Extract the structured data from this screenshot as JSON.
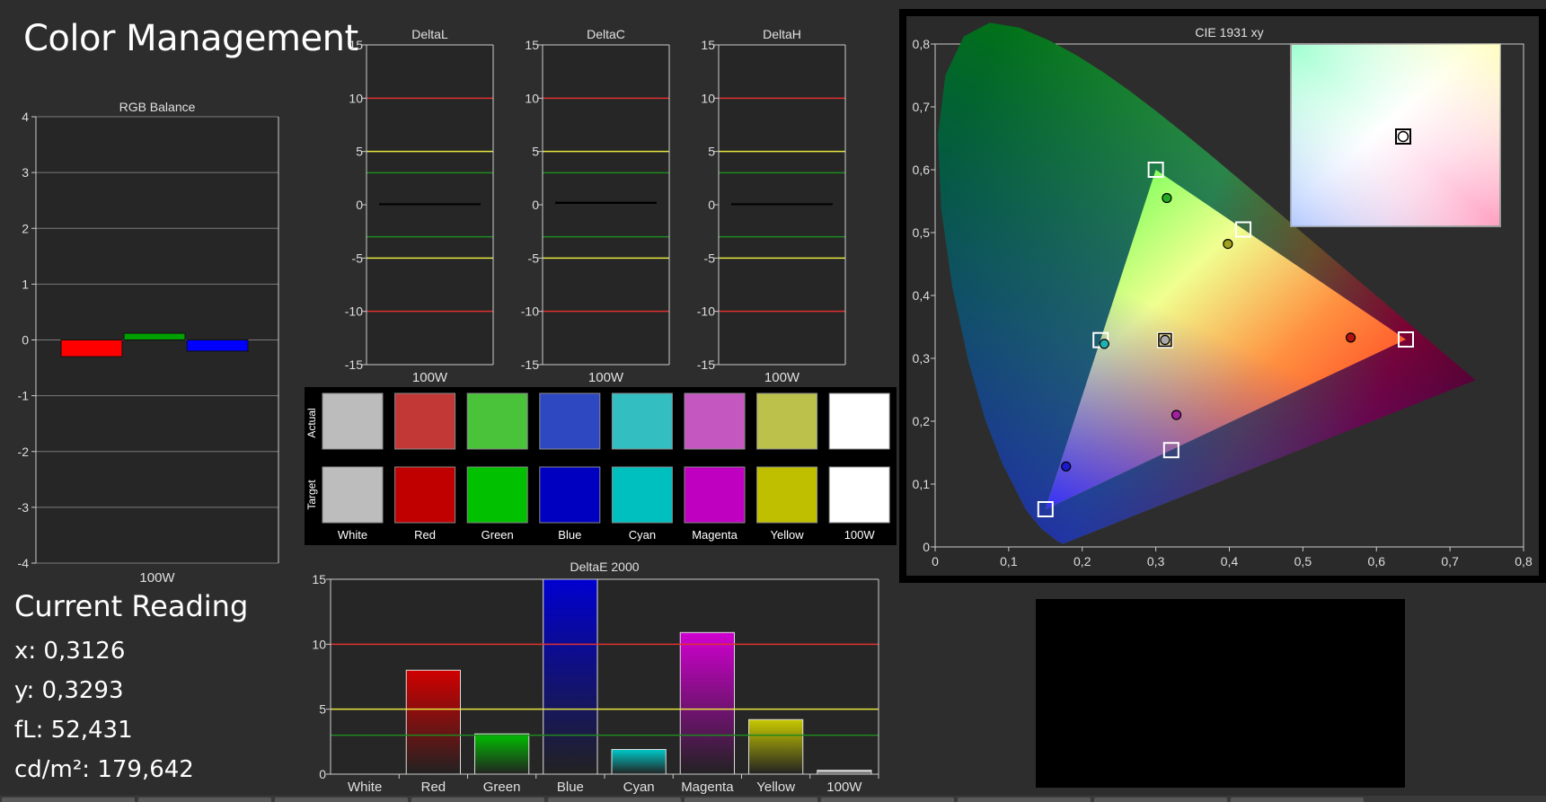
{
  "page": {
    "title": "Color Management",
    "colors": {
      "background": "#2d2d2d",
      "panel": "#262626",
      "grid": "#7a7a7a"
    }
  },
  "current_reading": {
    "heading": "Current Reading",
    "x_line": "x: 0,3126",
    "y_line": "y: 0,3293",
    "fl_line": "fL: 52,431",
    "cdm2_line": "cd/m²: 179,642"
  },
  "swatches": {
    "row_labels": [
      "Actual",
      "Target"
    ],
    "names": [
      "White",
      "Red",
      "Green",
      "Blue",
      "Cyan",
      "Magenta",
      "Yellow",
      "100W"
    ],
    "actual_colors": [
      "#bcbcbc",
      "#c23837",
      "#4ac33b",
      "#2e48c2",
      "#33bfc1",
      "#c458c0",
      "#bcc14b",
      "#ffffff"
    ],
    "target_colors": [
      "#bdbdbd",
      "#c00000",
      "#00c000",
      "#0000c0",
      "#00bfbf",
      "#c000c0",
      "#bfbf00",
      "#ffffff"
    ]
  },
  "chart_data": [
    {
      "type": "bar",
      "title": "RGB Balance",
      "categories": [
        "100W"
      ],
      "series": [
        {
          "color": "#ff0000",
          "values": [
            -0.3
          ]
        },
        {
          "color": "#00a000",
          "values": [
            0.12
          ]
        },
        {
          "color": "#0000ff",
          "values": [
            -0.2
          ]
        }
      ],
      "ylim": [
        -4,
        4
      ],
      "yticks": [
        "-4",
        "-3",
        "-2",
        "-1",
        "0",
        "1",
        "2",
        "3",
        "4"
      ],
      "grid": true
    },
    {
      "type": "bar",
      "title": "DeltaL",
      "categories": [
        "100W"
      ],
      "values": [
        0.05
      ],
      "ylim": [
        -15,
        15
      ],
      "yticks": [
        "-15",
        "-10",
        "-5",
        "0",
        "5",
        "10",
        "15"
      ],
      "reference_lines": [
        {
          "value": 10,
          "color": "#e03030"
        },
        {
          "value": 5,
          "color": "#e8e840"
        },
        {
          "value": 3,
          "color": "#1f8a1f"
        },
        {
          "value": -3,
          "color": "#1f8a1f"
        },
        {
          "value": -5,
          "color": "#e8e840"
        },
        {
          "value": -10,
          "color": "#e03030"
        }
      ]
    },
    {
      "type": "bar",
      "title": "DeltaC",
      "categories": [
        "100W"
      ],
      "values": [
        0.2
      ],
      "ylim": [
        -15,
        15
      ],
      "yticks": [
        "-15",
        "-10",
        "-5",
        "0",
        "5",
        "10",
        "15"
      ],
      "reference_lines": [
        {
          "value": 10,
          "color": "#e03030"
        },
        {
          "value": 5,
          "color": "#e8e840"
        },
        {
          "value": 3,
          "color": "#1f8a1f"
        },
        {
          "value": -3,
          "color": "#1f8a1f"
        },
        {
          "value": -5,
          "color": "#e8e840"
        },
        {
          "value": -10,
          "color": "#e03030"
        }
      ]
    },
    {
      "type": "bar",
      "title": "DeltaH",
      "categories": [
        "100W"
      ],
      "values": [
        0.05
      ],
      "ylim": [
        -15,
        15
      ],
      "yticks": [
        "-15",
        "-10",
        "-5",
        "0",
        "5",
        "10",
        "15"
      ],
      "reference_lines": [
        {
          "value": 10,
          "color": "#e03030"
        },
        {
          "value": 5,
          "color": "#e8e840"
        },
        {
          "value": 3,
          "color": "#1f8a1f"
        },
        {
          "value": -3,
          "color": "#1f8a1f"
        },
        {
          "value": -5,
          "color": "#e8e840"
        },
        {
          "value": -10,
          "color": "#e03030"
        }
      ]
    },
    {
      "type": "bar",
      "title": "DeltaE 2000",
      "categories": [
        "White",
        "Red",
        "Green",
        "Blue",
        "Cyan",
        "Magenta",
        "Yellow",
        "100W"
      ],
      "values": [
        0,
        8,
        3.1,
        15.3,
        1.9,
        10.9,
        4.2,
        0.3
      ],
      "colors": [
        "#bdbdbd",
        "#d00000",
        "#00c000",
        "#0000d0",
        "#00c8c8",
        "#d000d0",
        "#c8c800",
        "#ffffff"
      ],
      "ylim": [
        0,
        15
      ],
      "yticks": [
        "0",
        "5",
        "10",
        "15"
      ],
      "reference_lines": [
        {
          "value": 10,
          "color": "#e03030"
        },
        {
          "value": 5,
          "color": "#e8e840"
        },
        {
          "value": 3,
          "color": "#1f8a1f"
        }
      ]
    },
    {
      "type": "scatter",
      "title": "CIE 1931 xy",
      "xlim": [
        0,
        0.8
      ],
      "ylim": [
        0,
        0.8
      ],
      "xticks": [
        "0",
        "0,1",
        "0,2",
        "0,3",
        "0,4",
        "0,5",
        "0,6",
        "0,7",
        "0,8"
      ],
      "yticks": [
        "0",
        "0,1",
        "0,2",
        "0,3",
        "0,4",
        "0,5",
        "0,6",
        "0,7",
        "0,8"
      ],
      "targets": [
        {
          "name": "Red",
          "x": 0.64,
          "y": 0.33
        },
        {
          "name": "Green",
          "x": 0.3,
          "y": 0.6
        },
        {
          "name": "Blue",
          "x": 0.15,
          "y": 0.06
        },
        {
          "name": "Cyan",
          "x": 0.225,
          "y": 0.329
        },
        {
          "name": "Magenta",
          "x": 0.321,
          "y": 0.154
        },
        {
          "name": "Yellow",
          "x": 0.419,
          "y": 0.505
        },
        {
          "name": "White",
          "x": 0.3127,
          "y": 0.329
        }
      ],
      "actuals": [
        {
          "name": "Red",
          "x": 0.565,
          "y": 0.333,
          "color": "#b01010"
        },
        {
          "name": "Green",
          "x": 0.315,
          "y": 0.555,
          "color": "#22aa22"
        },
        {
          "name": "Blue",
          "x": 0.178,
          "y": 0.128,
          "color": "#1a1acc"
        },
        {
          "name": "Cyan",
          "x": 0.23,
          "y": 0.323,
          "color": "#20b0b0"
        },
        {
          "name": "Magenta",
          "x": 0.328,
          "y": 0.21,
          "color": "#a020a0"
        },
        {
          "name": "Yellow",
          "x": 0.398,
          "y": 0.482,
          "color": "#a0a020"
        },
        {
          "name": "White",
          "x": 0.3126,
          "y": 0.3293,
          "color": "#aaaaaa"
        }
      ]
    }
  ]
}
